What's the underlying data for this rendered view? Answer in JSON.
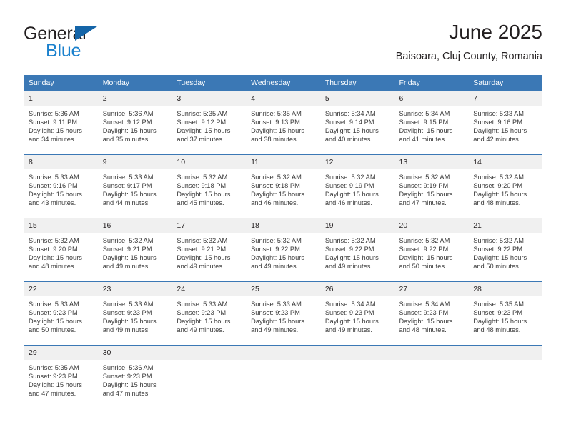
{
  "brand": {
    "name_part1": "General",
    "name_part2": "Blue",
    "triangle_color": "#1565a8",
    "blue_color": "#1b81cd"
  },
  "header": {
    "title": "June 2025",
    "subtitle": "Baisoara, Cluj County, Romania"
  },
  "theme": {
    "header_bg": "#3b78b5",
    "daynum_bg": "#f0f0f0",
    "text_color": "#231f20",
    "cell_text_color": "#3a3a3a"
  },
  "calendar": {
    "weekday_headers": [
      "Sunday",
      "Monday",
      "Tuesday",
      "Wednesday",
      "Thursday",
      "Friday",
      "Saturday"
    ],
    "weeks": [
      [
        {
          "day": "1",
          "sunrise": "Sunrise: 5:36 AM",
          "sunset": "Sunset: 9:11 PM",
          "daylight_line1": "Daylight: 15 hours",
          "daylight_line2": "and 34 minutes."
        },
        {
          "day": "2",
          "sunrise": "Sunrise: 5:36 AM",
          "sunset": "Sunset: 9:12 PM",
          "daylight_line1": "Daylight: 15 hours",
          "daylight_line2": "and 35 minutes."
        },
        {
          "day": "3",
          "sunrise": "Sunrise: 5:35 AM",
          "sunset": "Sunset: 9:12 PM",
          "daylight_line1": "Daylight: 15 hours",
          "daylight_line2": "and 37 minutes."
        },
        {
          "day": "4",
          "sunrise": "Sunrise: 5:35 AM",
          "sunset": "Sunset: 9:13 PM",
          "daylight_line1": "Daylight: 15 hours",
          "daylight_line2": "and 38 minutes."
        },
        {
          "day": "5",
          "sunrise": "Sunrise: 5:34 AM",
          "sunset": "Sunset: 9:14 PM",
          "daylight_line1": "Daylight: 15 hours",
          "daylight_line2": "and 40 minutes."
        },
        {
          "day": "6",
          "sunrise": "Sunrise: 5:34 AM",
          "sunset": "Sunset: 9:15 PM",
          "daylight_line1": "Daylight: 15 hours",
          "daylight_line2": "and 41 minutes."
        },
        {
          "day": "7",
          "sunrise": "Sunrise: 5:33 AM",
          "sunset": "Sunset: 9:16 PM",
          "daylight_line1": "Daylight: 15 hours",
          "daylight_line2": "and 42 minutes."
        }
      ],
      [
        {
          "day": "8",
          "sunrise": "Sunrise: 5:33 AM",
          "sunset": "Sunset: 9:16 PM",
          "daylight_line1": "Daylight: 15 hours",
          "daylight_line2": "and 43 minutes."
        },
        {
          "day": "9",
          "sunrise": "Sunrise: 5:33 AM",
          "sunset": "Sunset: 9:17 PM",
          "daylight_line1": "Daylight: 15 hours",
          "daylight_line2": "and 44 minutes."
        },
        {
          "day": "10",
          "sunrise": "Sunrise: 5:32 AM",
          "sunset": "Sunset: 9:18 PM",
          "daylight_line1": "Daylight: 15 hours",
          "daylight_line2": "and 45 minutes."
        },
        {
          "day": "11",
          "sunrise": "Sunrise: 5:32 AM",
          "sunset": "Sunset: 9:18 PM",
          "daylight_line1": "Daylight: 15 hours",
          "daylight_line2": "and 46 minutes."
        },
        {
          "day": "12",
          "sunrise": "Sunrise: 5:32 AM",
          "sunset": "Sunset: 9:19 PM",
          "daylight_line1": "Daylight: 15 hours",
          "daylight_line2": "and 46 minutes."
        },
        {
          "day": "13",
          "sunrise": "Sunrise: 5:32 AM",
          "sunset": "Sunset: 9:19 PM",
          "daylight_line1": "Daylight: 15 hours",
          "daylight_line2": "and 47 minutes."
        },
        {
          "day": "14",
          "sunrise": "Sunrise: 5:32 AM",
          "sunset": "Sunset: 9:20 PM",
          "daylight_line1": "Daylight: 15 hours",
          "daylight_line2": "and 48 minutes."
        }
      ],
      [
        {
          "day": "15",
          "sunrise": "Sunrise: 5:32 AM",
          "sunset": "Sunset: 9:20 PM",
          "daylight_line1": "Daylight: 15 hours",
          "daylight_line2": "and 48 minutes."
        },
        {
          "day": "16",
          "sunrise": "Sunrise: 5:32 AM",
          "sunset": "Sunset: 9:21 PM",
          "daylight_line1": "Daylight: 15 hours",
          "daylight_line2": "and 49 minutes."
        },
        {
          "day": "17",
          "sunrise": "Sunrise: 5:32 AM",
          "sunset": "Sunset: 9:21 PM",
          "daylight_line1": "Daylight: 15 hours",
          "daylight_line2": "and 49 minutes."
        },
        {
          "day": "18",
          "sunrise": "Sunrise: 5:32 AM",
          "sunset": "Sunset: 9:22 PM",
          "daylight_line1": "Daylight: 15 hours",
          "daylight_line2": "and 49 minutes."
        },
        {
          "day": "19",
          "sunrise": "Sunrise: 5:32 AM",
          "sunset": "Sunset: 9:22 PM",
          "daylight_line1": "Daylight: 15 hours",
          "daylight_line2": "and 49 minutes."
        },
        {
          "day": "20",
          "sunrise": "Sunrise: 5:32 AM",
          "sunset": "Sunset: 9:22 PM",
          "daylight_line1": "Daylight: 15 hours",
          "daylight_line2": "and 50 minutes."
        },
        {
          "day": "21",
          "sunrise": "Sunrise: 5:32 AM",
          "sunset": "Sunset: 9:22 PM",
          "daylight_line1": "Daylight: 15 hours",
          "daylight_line2": "and 50 minutes."
        }
      ],
      [
        {
          "day": "22",
          "sunrise": "Sunrise: 5:33 AM",
          "sunset": "Sunset: 9:23 PM",
          "daylight_line1": "Daylight: 15 hours",
          "daylight_line2": "and 50 minutes."
        },
        {
          "day": "23",
          "sunrise": "Sunrise: 5:33 AM",
          "sunset": "Sunset: 9:23 PM",
          "daylight_line1": "Daylight: 15 hours",
          "daylight_line2": "and 49 minutes."
        },
        {
          "day": "24",
          "sunrise": "Sunrise: 5:33 AM",
          "sunset": "Sunset: 9:23 PM",
          "daylight_line1": "Daylight: 15 hours",
          "daylight_line2": "and 49 minutes."
        },
        {
          "day": "25",
          "sunrise": "Sunrise: 5:33 AM",
          "sunset": "Sunset: 9:23 PM",
          "daylight_line1": "Daylight: 15 hours",
          "daylight_line2": "and 49 minutes."
        },
        {
          "day": "26",
          "sunrise": "Sunrise: 5:34 AM",
          "sunset": "Sunset: 9:23 PM",
          "daylight_line1": "Daylight: 15 hours",
          "daylight_line2": "and 49 minutes."
        },
        {
          "day": "27",
          "sunrise": "Sunrise: 5:34 AM",
          "sunset": "Sunset: 9:23 PM",
          "daylight_line1": "Daylight: 15 hours",
          "daylight_line2": "and 48 minutes."
        },
        {
          "day": "28",
          "sunrise": "Sunrise: 5:35 AM",
          "sunset": "Sunset: 9:23 PM",
          "daylight_line1": "Daylight: 15 hours",
          "daylight_line2": "and 48 minutes."
        }
      ],
      [
        {
          "day": "29",
          "sunrise": "Sunrise: 5:35 AM",
          "sunset": "Sunset: 9:23 PM",
          "daylight_line1": "Daylight: 15 hours",
          "daylight_line2": "and 47 minutes."
        },
        {
          "day": "30",
          "sunrise": "Sunrise: 5:36 AM",
          "sunset": "Sunset: 9:23 PM",
          "daylight_line1": "Daylight: 15 hours",
          "daylight_line2": "and 47 minutes."
        },
        {
          "day": "",
          "sunrise": "",
          "sunset": "",
          "daylight_line1": "",
          "daylight_line2": ""
        },
        {
          "day": "",
          "sunrise": "",
          "sunset": "",
          "daylight_line1": "",
          "daylight_line2": ""
        },
        {
          "day": "",
          "sunrise": "",
          "sunset": "",
          "daylight_line1": "",
          "daylight_line2": ""
        },
        {
          "day": "",
          "sunrise": "",
          "sunset": "",
          "daylight_line1": "",
          "daylight_line2": ""
        },
        {
          "day": "",
          "sunrise": "",
          "sunset": "",
          "daylight_line1": "",
          "daylight_line2": ""
        }
      ]
    ]
  }
}
